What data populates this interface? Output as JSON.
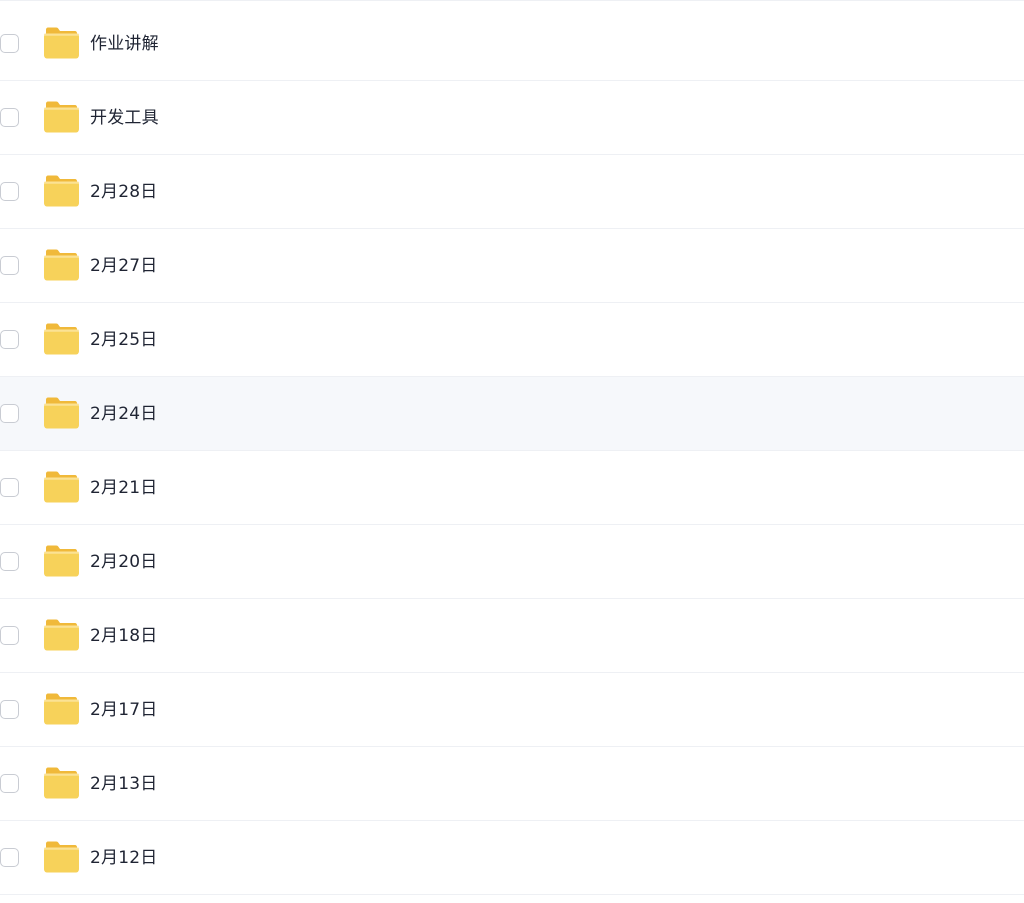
{
  "file_list": {
    "hover_index": 5,
    "items": [
      {
        "name": "作业讲解",
        "type": "folder",
        "icon": "folder-icon",
        "checked": false
      },
      {
        "name": "开发工具",
        "type": "folder",
        "icon": "folder-icon",
        "checked": false
      },
      {
        "name": "2月28日",
        "type": "folder",
        "icon": "folder-icon",
        "checked": false
      },
      {
        "name": "2月27日",
        "type": "folder",
        "icon": "folder-icon",
        "checked": false
      },
      {
        "name": "2月25日",
        "type": "folder",
        "icon": "folder-icon",
        "checked": false
      },
      {
        "name": "2月24日",
        "type": "folder",
        "icon": "folder-icon",
        "checked": false
      },
      {
        "name": "2月21日",
        "type": "folder",
        "icon": "folder-icon",
        "checked": false
      },
      {
        "name": "2月20日",
        "type": "folder",
        "icon": "folder-icon",
        "checked": false
      },
      {
        "name": "2月18日",
        "type": "folder",
        "icon": "folder-icon",
        "checked": false
      },
      {
        "name": "2月17日",
        "type": "folder",
        "icon": "folder-icon",
        "checked": false
      },
      {
        "name": "2月13日",
        "type": "folder",
        "icon": "folder-icon",
        "checked": false
      },
      {
        "name": "2月12日",
        "type": "folder",
        "icon": "folder-icon",
        "checked": false
      }
    ]
  },
  "colors": {
    "folder_body": "#f7d25a",
    "folder_back": "#f0b93a",
    "hover_bg": "#f6f8fb",
    "divider": "#eef0f4",
    "text": "#1f2433",
    "checkbox_border": "#c9ccd3"
  }
}
